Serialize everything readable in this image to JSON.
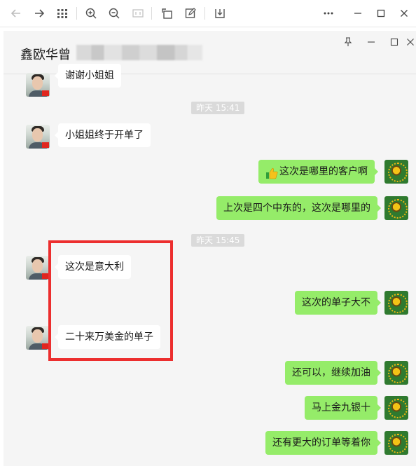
{
  "toolbar": {
    "icons": [
      "back-arrow-icon",
      "forward-arrow-icon",
      "grid-icon",
      "zoom-in-icon",
      "zoom-out-icon",
      "fit-icon",
      "rotate-icon",
      "edit-icon",
      "download-icon",
      "more-icon",
      "minimize-icon",
      "maximize-icon",
      "close-icon"
    ]
  },
  "chat": {
    "title": "鑫欧华曾",
    "window_controls": [
      "pin-icon",
      "minimize-icon",
      "maximize-icon",
      "close-icon"
    ]
  },
  "messages": [
    {
      "side": "left",
      "text": "谢谢小姐姐"
    },
    {
      "timestamp": "昨天 15:41"
    },
    {
      "side": "left",
      "text": "小姐姐终于开单了"
    },
    {
      "side": "right",
      "text": "这次是哪里的客户啊",
      "emoji": "thumbs-up"
    },
    {
      "side": "right",
      "text": "上次是四个中东的，这次是哪里的"
    },
    {
      "timestamp": "昨天 15:45"
    },
    {
      "side": "left",
      "text": "这次是意大利"
    },
    {
      "side": "right",
      "text": "这次的单子大不"
    },
    {
      "side": "left",
      "text": "二十来万美金的单子"
    },
    {
      "side": "right",
      "text": "还可以，继续加油"
    },
    {
      "side": "right",
      "text": "马上金九银十"
    },
    {
      "side": "right",
      "text": "还有更大的订单等着你"
    }
  ],
  "colors": {
    "right_bubble": "#95ec69",
    "left_bubble": "#ffffff",
    "chat_bg": "#f5f5f5",
    "highlight_box": "#ec2e2e"
  }
}
